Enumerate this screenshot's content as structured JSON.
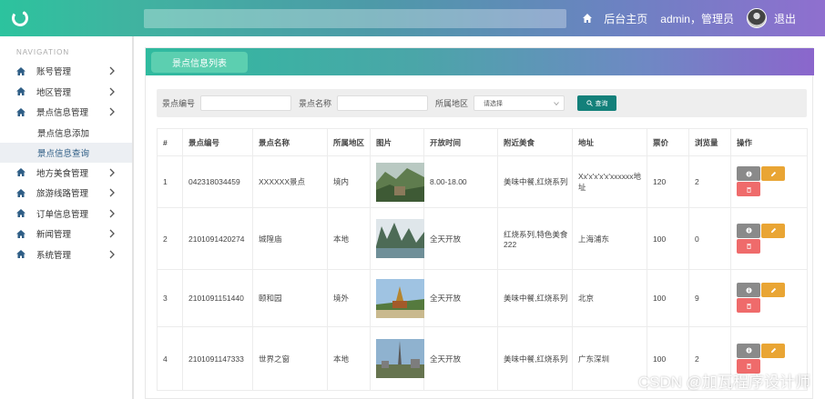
{
  "header": {
    "home_label": "后台主页",
    "user_label": "admin，管理员",
    "logout_label": "退出"
  },
  "sidebar": {
    "title": "NAVIGATION",
    "items": [
      {
        "label": "账号管理"
      },
      {
        "label": "地区管理"
      },
      {
        "label": "景点信息管理"
      },
      {
        "label": "景点信息添加"
      },
      {
        "label": "景点信息查询"
      },
      {
        "label": "地方美食管理"
      },
      {
        "label": "旅游线路管理"
      },
      {
        "label": "订单信息管理"
      },
      {
        "label": "新闻管理"
      },
      {
        "label": "系统管理"
      }
    ]
  },
  "panel": {
    "tab_label": "景点信息列表"
  },
  "filter": {
    "code_label": "景点编号",
    "name_label": "景点名称",
    "region_label": "所属地区",
    "region_select": "请选择",
    "search_button": "查询"
  },
  "table": {
    "headers": [
      "#",
      "景点编号",
      "景点名称",
      "所属地区",
      "图片",
      "开放时间",
      "附近美食",
      "地址",
      "票价",
      "浏览量",
      "操作"
    ],
    "rows": [
      {
        "num": "1",
        "code": "042318034459",
        "name": "XXXXXX景点",
        "region": "境内",
        "hours": "8.00-18.00",
        "food": "美味中餐,红烧系列",
        "address": "Xx'x'x'x'x'xxxxxx地址",
        "price": "120",
        "views": "2"
      },
      {
        "num": "2",
        "code": "2101091420274",
        "name": "城隍庙",
        "region": "本地",
        "hours": "全天开放",
        "food": "红烧系列,特色美食222",
        "address": "上海浦东",
        "price": "100",
        "views": "0"
      },
      {
        "num": "3",
        "code": "2101091151440",
        "name": "颐和园",
        "region": "境外",
        "hours": "全天开放",
        "food": "美味中餐,红烧系列",
        "address": "北京",
        "price": "100",
        "views": "9"
      },
      {
        "num": "4",
        "code": "2101091147333",
        "name": "世界之窗",
        "region": "本地",
        "hours": "全天开放",
        "food": "美味中餐,红烧系列",
        "address": "广东深圳",
        "price": "100",
        "views": "2"
      }
    ]
  },
  "watermark": "CSDN @加瓦程序设计师",
  "colors": {
    "header_start": "#2cc39e",
    "header_end": "#8f6fcf",
    "search_button": "#13807a",
    "info_button": "#8a8a8a",
    "edit_button": "#e9a534",
    "delete_button": "#ef6b6b"
  }
}
